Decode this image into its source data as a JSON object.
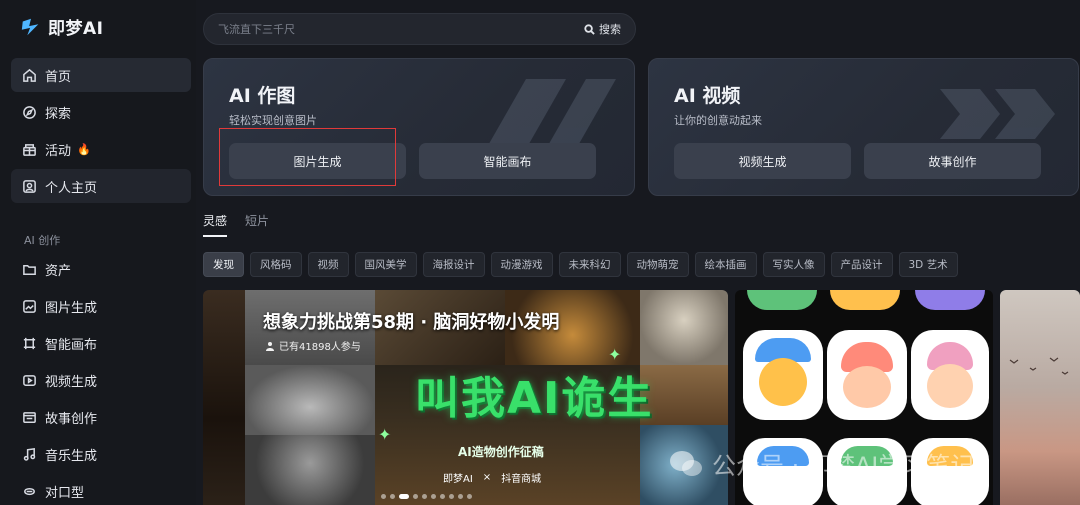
{
  "app": {
    "logo_text": "即梦AI"
  },
  "sidebar": {
    "main_items": [
      {
        "label": "首页",
        "icon": "home-icon",
        "active": true
      },
      {
        "label": "探索",
        "icon": "compass-icon"
      },
      {
        "label": "活动",
        "icon": "gift-icon",
        "badge": "fire-icon"
      },
      {
        "label": "个人主页",
        "icon": "user-icon"
      }
    ],
    "section_title": "AI 创作",
    "create_items": [
      {
        "label": "资产",
        "icon": "folder-icon"
      },
      {
        "label": "图片生成",
        "icon": "image-gen-icon"
      },
      {
        "label": "智能画布",
        "icon": "canvas-icon"
      },
      {
        "label": "视频生成",
        "icon": "video-gen-icon"
      },
      {
        "label": "故事创作",
        "icon": "story-icon"
      },
      {
        "label": "音乐生成",
        "icon": "music-icon"
      },
      {
        "label": "对口型",
        "icon": "lipsync-icon"
      }
    ]
  },
  "search": {
    "placeholder": "飞流直下三千尺",
    "button_label": "搜索"
  },
  "cards": [
    {
      "title": "AI 作图",
      "subtitle": "轻松实现创意图片",
      "buttons": [
        "图片生成",
        "智能画布"
      ]
    },
    {
      "title": "AI 视频",
      "subtitle": "让你的创意动起来",
      "buttons": [
        "视频生成",
        "故事创作"
      ]
    }
  ],
  "tabs": [
    {
      "label": "灵感",
      "active": true
    },
    {
      "label": "短片"
    }
  ],
  "categories": [
    "发现",
    "风格码",
    "视频",
    "国风美学",
    "海报设计",
    "动漫游戏",
    "未来科幻",
    "动物萌宠",
    "绘本插画",
    "写实人像",
    "产品设计",
    "3D 艺术"
  ],
  "active_category": "发现",
  "feed": {
    "banner": {
      "title": "想象力挑战第58期 · 脑洞好物小发明",
      "participants": "已有41898人参与",
      "headline": "叫我AI诡生",
      "subheadline": "AI造物创作征稿",
      "brand_left": "即梦AI",
      "brand_right": "抖音商城"
    }
  },
  "watermark": {
    "text": "公众号 · 即梦AI学习笔记"
  },
  "colors": {
    "highlight": "#e03a3a",
    "accent_green": "#39e06a",
    "background": "#17191f"
  }
}
